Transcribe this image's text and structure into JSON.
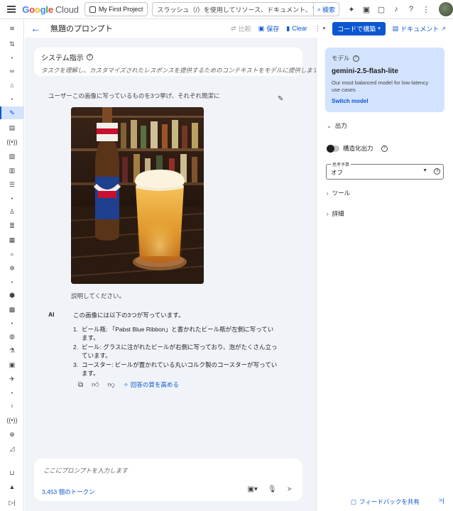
{
  "topbar": {
    "logo_main": "Google",
    "logo_sub": "Cloud",
    "project": "My First Project",
    "search_placeholder": "スラッシュ（/）を使用してリソース、ドキュメント、プロダク",
    "search_button": "検索"
  },
  "header": {
    "title": "無題のプロンプト",
    "compare": "比較",
    "save": "保存",
    "clear": "Clear",
    "build_with_code": "コードで構築",
    "docs": "ドキュメント"
  },
  "system_instructions": {
    "title": "システム指示",
    "placeholder": "タスクを理解し、カスタマイズされたレスポンスを提供するためのコンテキストをモデルに提供します"
  },
  "conversation": {
    "user_text": "ユーザーこの画像に写っているものを3つ挙げ、それぞれ簡潔に",
    "user_followup": "説明してください。",
    "ai_label": "AI",
    "ai_intro": "この画像には以下の3つが写っています。",
    "ai_items": [
      {
        "num": "1.",
        "text": "ビール瓶: 「Pabst Blue Ribbon」と書かれたビール瓶が左側に写っています。"
      },
      {
        "num": "2.",
        "text": "ビール: グラスに注がれたビールが右側に写っており、泡がたくさん立っています。"
      },
      {
        "num": "3.",
        "text": "コースター: ビールが置かれている丸いコルク製のコースターが写っています。"
      }
    ],
    "improve": "回答の質を高める"
  },
  "prompt": {
    "placeholder": "ここにプロンプトを入力します",
    "tokens": "3,453 個のトークン"
  },
  "right_panel": {
    "model_label": "モデル",
    "model_name": "gemini-2.5-flash-lite",
    "model_desc": "Our most balanced model for low-latency use cases",
    "switch_model": "Switch model",
    "output": "出力",
    "structured_output": "構造化出力",
    "thinking_budget_label": "思考予算",
    "thinking_budget_value": "オフ",
    "tools": "ツール",
    "details": "詳細",
    "share_feedback": "フィードバックを共有"
  },
  "colors": {
    "accent": "#0b57d0",
    "chat_bg": "#f0f4f9",
    "model_card": "#d3e3fd"
  }
}
